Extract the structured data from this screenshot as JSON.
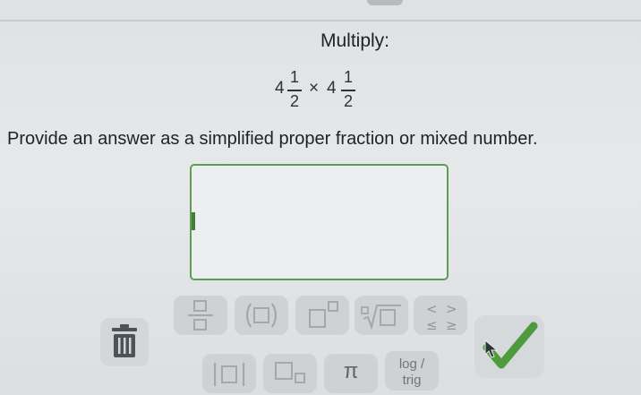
{
  "question": {
    "title": "Multiply:",
    "expression": {
      "whole1": "4",
      "num1": "1",
      "den1": "2",
      "operator": "×",
      "whole2": "4",
      "num2": "1",
      "den2": "2"
    },
    "instructions": "Provide an answer as a simplified proper fraction or mixed number."
  },
  "answer": {
    "value": ""
  },
  "keypad": {
    "keys": [
      {
        "id": "fraction",
        "icon": "fraction-template-icon"
      },
      {
        "id": "parentheses",
        "icon": "parentheses-template-icon"
      },
      {
        "id": "exponent",
        "icon": "exponent-template-icon"
      },
      {
        "id": "nth-root",
        "icon": "nth-root-template-icon"
      },
      {
        "id": "inequality",
        "icon": "inequality-symbols-icon",
        "symbols": [
          "<",
          ">",
          "≤",
          "≥"
        ]
      },
      {
        "id": "absolute-value",
        "icon": "absolute-value-template-icon"
      },
      {
        "id": "subscript",
        "icon": "subscript-template-icon"
      },
      {
        "id": "pi",
        "label": "π"
      },
      {
        "id": "log-trig",
        "label_top": "log /",
        "label_bottom": "trig"
      }
    ],
    "delete_icon": "trash-icon",
    "submit_icon": "checkmark-icon"
  },
  "colors": {
    "accent": "#5f9d54",
    "check": "#4f9a3c",
    "background": "#e3e5e7"
  }
}
